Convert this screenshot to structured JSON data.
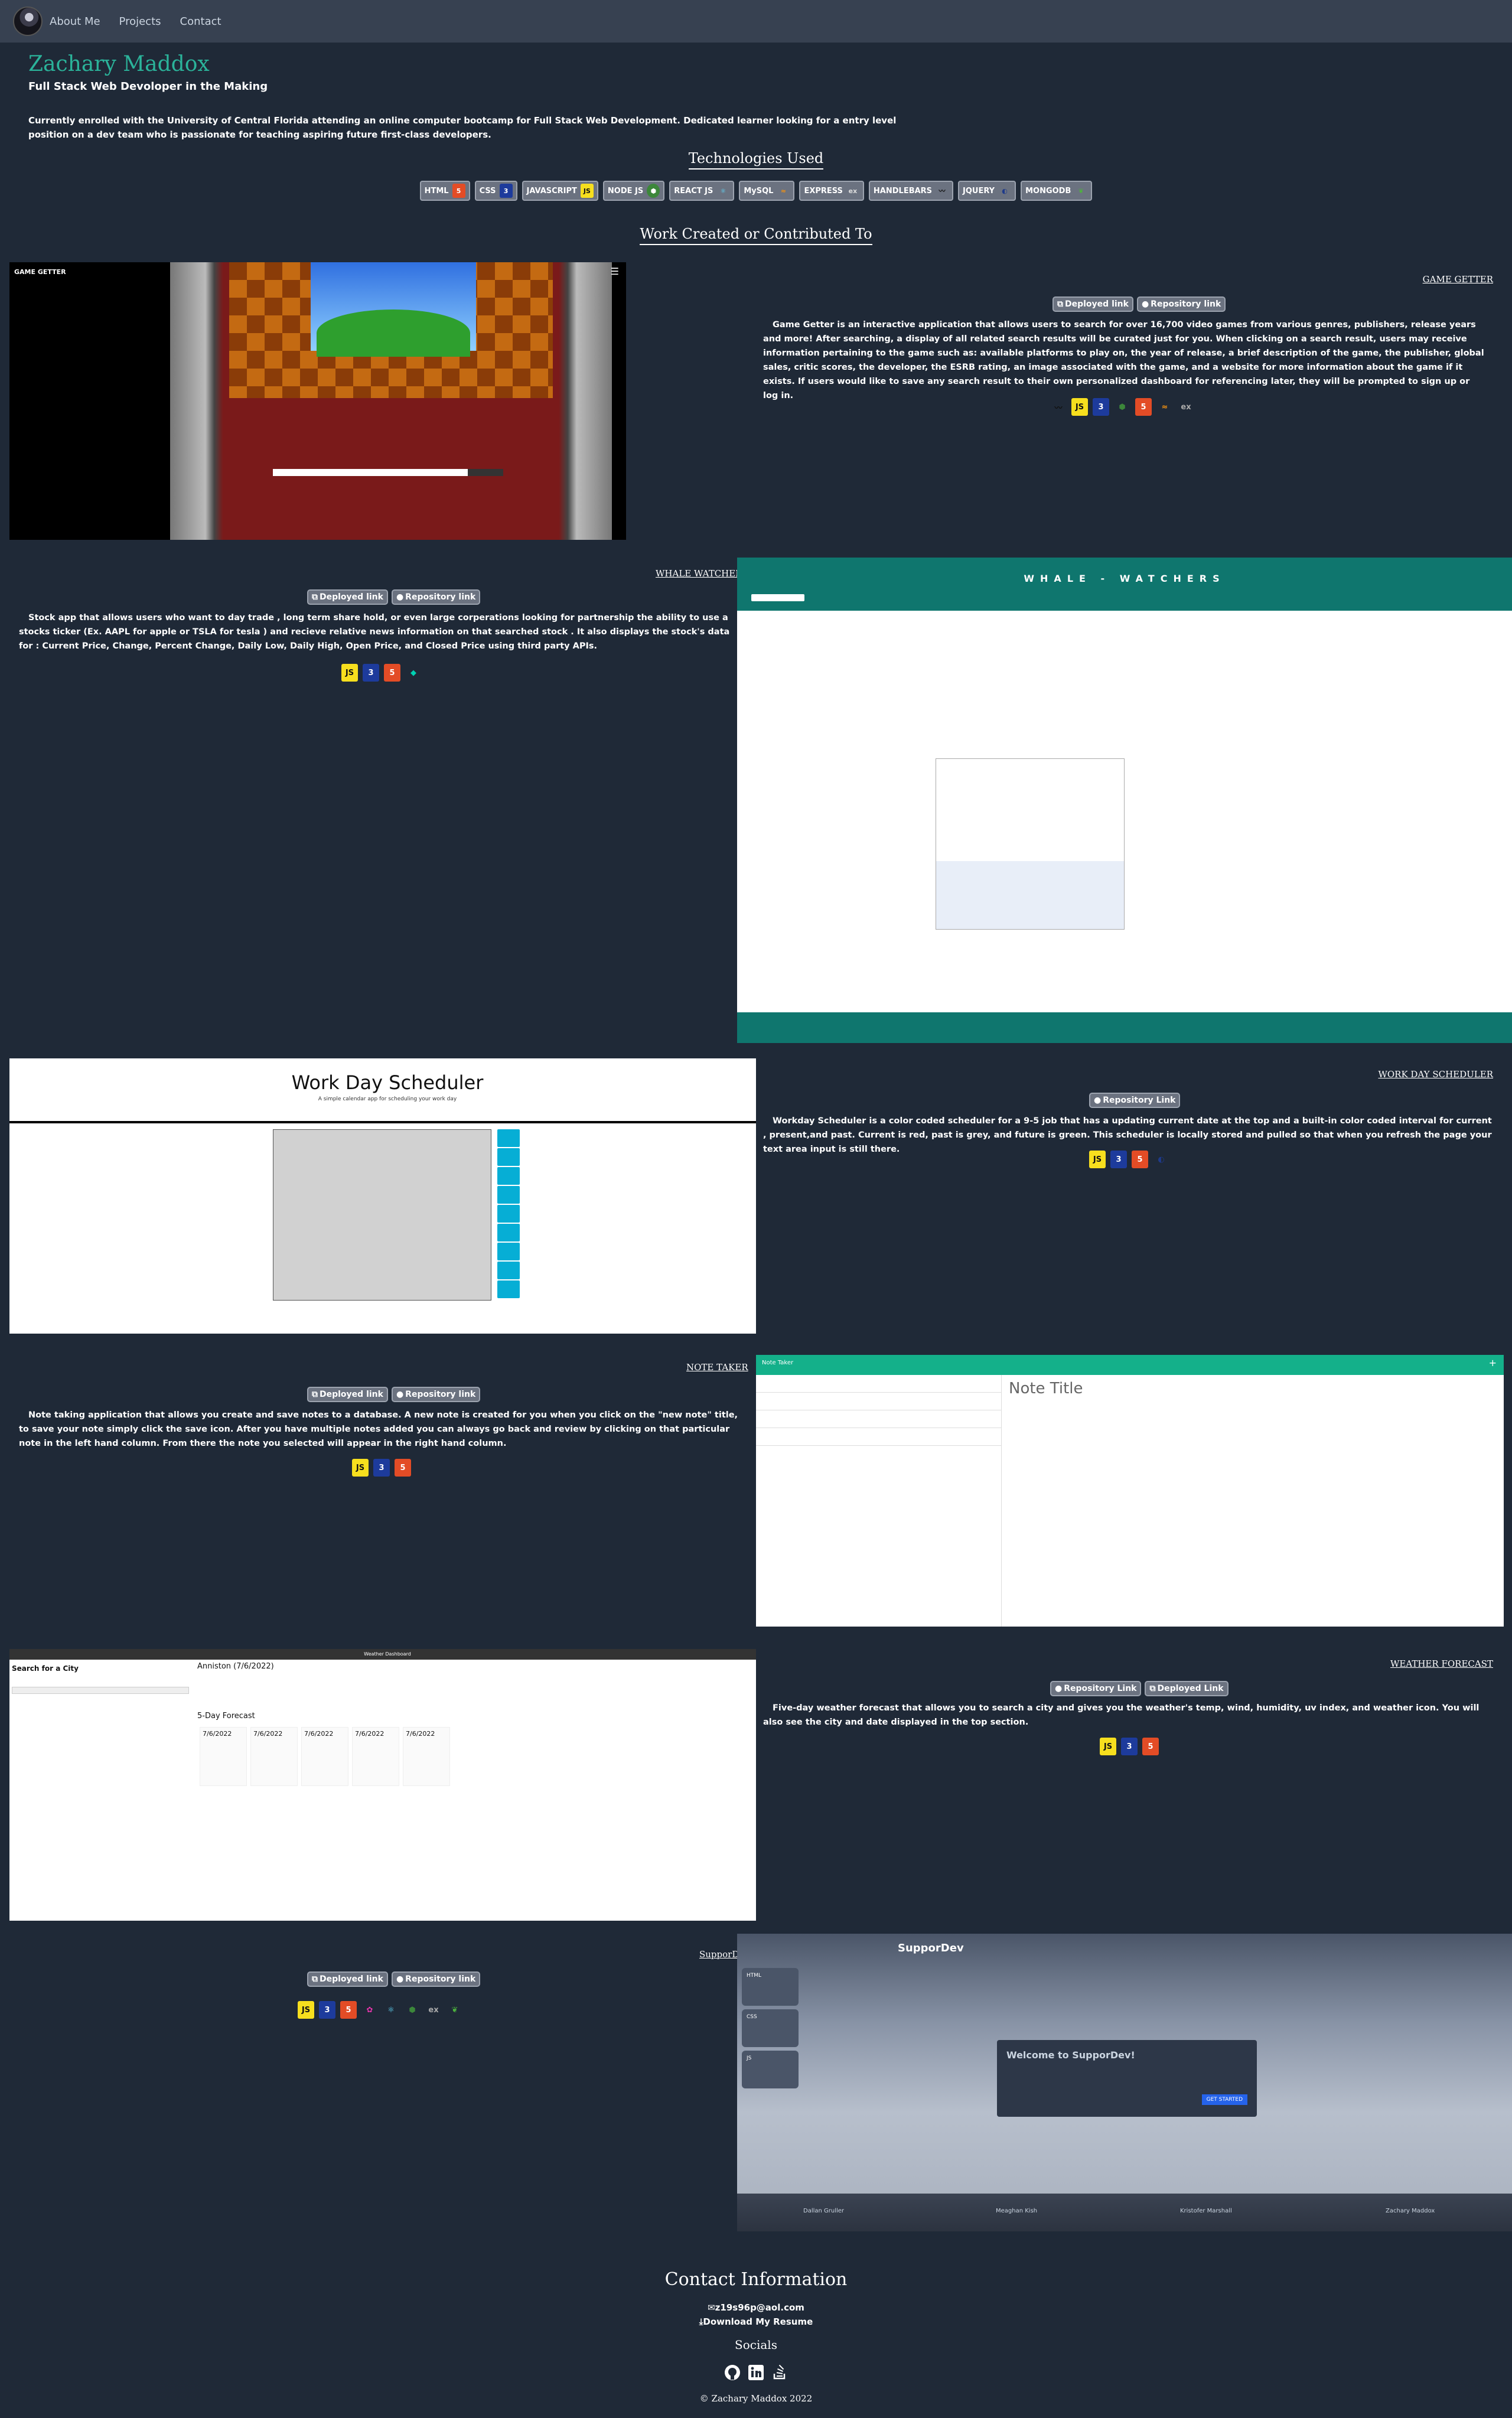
{
  "nav": {
    "links": [
      "About Me",
      "Projects",
      "Contact"
    ]
  },
  "header": {
    "name": "Zachary Maddox",
    "role": "Full Stack Web Devoloper in the Making",
    "bio": "Currently enrolled with the University of Central Florida attending an online computer bootcamp for Full Stack Web Development. Dedicated learner looking for a entry level position on a dev team who is passionate for teaching aspiring future first-class developers."
  },
  "technologies": {
    "title": "Technologies Used",
    "items": [
      {
        "label": "HTML",
        "icon": "html5-icon",
        "color": "#e34c26"
      },
      {
        "label": "CSS",
        "icon": "css3-icon",
        "color": "#1d3b9c"
      },
      {
        "label": "JAVASCRIPT",
        "icon": "js-icon",
        "color": "#f7df1e"
      },
      {
        "label": "NODE JS",
        "icon": "nodejs-icon",
        "color": "#3c873a"
      },
      {
        "label": "REACT JS",
        "icon": "react-icon",
        "color": "#61dafb"
      },
      {
        "label": "MySQL",
        "icon": "mysql-icon",
        "color": "#f29111"
      },
      {
        "label": "EXPRESS",
        "icon": "express-icon",
        "color": "#cccccc"
      },
      {
        "label": "HANDLEBARS",
        "icon": "handlebars-icon",
        "color": "#222222"
      },
      {
        "label": "JQUERY",
        "icon": "jquery-icon",
        "color": "#0769ad"
      },
      {
        "label": "MONGODB",
        "icon": "mongodb-icon",
        "color": "#4db33d"
      }
    ]
  },
  "work": {
    "title": "Work Created or Contributed To",
    "projects": [
      {
        "title": "GAME GETTER",
        "buttons": [
          "Deployed link",
          "Repository link"
        ],
        "description": "Game Getter is an interactive application that allows users to search for over 16,700 video games from various genres, publishers, release years and more! After searching, a display of all related search results will be curated just for you. When clicking on a search result, users may receive information pertaining to the game such as: available platforms to play on, the year of release, a brief description of the game, the publisher, global sales, critic scores, the developer, the ESRB rating, an image associated with the game, and a website for more information about the game if it exists. If users would like to save any search result to their own personalized dashboard for referencing later, they will be prompted to sign up or log in.",
        "screenshot_label": "GAME GETTER"
      },
      {
        "title": "WHALE WATCHERS",
        "buttons": [
          "Deployed link",
          "Repository link"
        ],
        "description": "Stock app that allows users who want to day trade , long term share hold, or even large corperations looking for partnership the ability to use a stocks ticker (Ex. AAPL for apple or TSLA for tesla ) and recieve relative news information on that searched stock . It also displays the stock's data for : Current Price, Change, Percent Change, Daily Low, Daily High, Open Price, and Closed Price using third party APIs.",
        "screenshot_label": "WHALE - WATCHERS"
      },
      {
        "title": "WORK DAY SCHEDULER",
        "buttons": [
          "Repository Link"
        ],
        "description": "Workday Scheduler is a color coded scheduler for a 9-5 job that has a updating current date at the top and a built-in color coded interval for current , present,and past. Current is red, past is grey, and future is green. This scheduler is locally stored and pulled so that when you refresh the page your text area input is still there.",
        "screenshot_label": "Work Day Scheduler",
        "screenshot_sub": "A simple calendar app for scheduling your work day"
      },
      {
        "title": "NOTE TAKER",
        "buttons": [
          "Deployed link",
          "Repository link"
        ],
        "description": "Note taking application that allows you create and save notes to a database. A new note is created for you when you click on the \"new note\" title, to save your note simply click the save icon. After you have multiple notes added you can always go back and review by clicking on that particular note in the left hand column. From there the note you selected will appear in the right hand column.",
        "screenshot_label": "Note Taker",
        "screenshot_note_title": "Note Title"
      },
      {
        "title": "WEATHER FORECAST",
        "buttons": [
          "Repository Link",
          "Deployed Link"
        ],
        "description": "Five-day weather forecast that allows you to search a city and gives you the weather's temp, wind, humidity, uv index, and weather icon. You will also see the city and date displayed in the top section.",
        "screenshot_label": "Weather Dashboard",
        "screenshot_search": "Search for a City",
        "screenshot_city": "Anniston (7/6/2022)",
        "screenshot_forecast": "5-Day Forecast",
        "screenshot_dates": [
          "7/6/2022",
          "7/6/2022",
          "7/6/2022",
          "7/6/2022",
          "7/6/2022"
        ]
      },
      {
        "title": "SupporDev",
        "buttons": [
          "Deployed link",
          "Repository link"
        ],
        "screenshot_label": "SupporDev",
        "screenshot_welcome": "Welcome to SupporDev!",
        "screenshot_cta": "GET STARTED",
        "screenshot_sidebar": [
          "HTML",
          "CSS",
          "JS"
        ],
        "screenshot_contributors": [
          "Dallan Gruller",
          "Meaghan Kish",
          "Kristofer Marshall",
          "Zachary Maddox"
        ]
      }
    ]
  },
  "contact": {
    "title": "Contact Information",
    "email": "z19s96p@aol.com",
    "resume": "Download My Resume",
    "socials_title": "Socials",
    "socials": [
      "github-icon",
      "linkedin-icon",
      "stackoverflow-icon"
    ],
    "copyright": "Zachary Maddox 2022"
  }
}
